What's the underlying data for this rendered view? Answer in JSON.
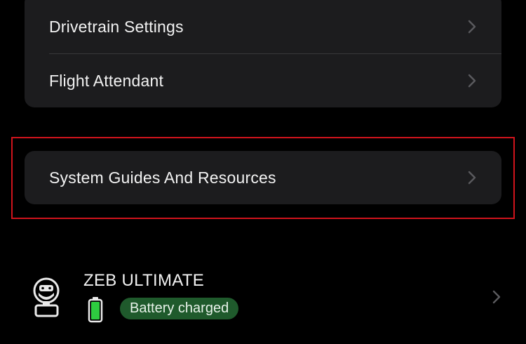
{
  "settings_group": {
    "items": [
      {
        "label": "Drivetrain Settings",
        "icon": "chevron-right-icon"
      },
      {
        "label": "Flight Attendant",
        "icon": "chevron-right-icon"
      }
    ]
  },
  "resources": {
    "label": "System Guides And Resources",
    "icon": "chevron-right-icon",
    "highlight_color": "#d0141c"
  },
  "device": {
    "name": "ZEB ULTIMATE",
    "icon": "zeb-robot-icon",
    "battery_icon": "battery-full-icon",
    "status": "Battery charged",
    "status_color": "#1f5a2c",
    "battery_color": "#2ecc40",
    "battery_level": 1.0
  }
}
